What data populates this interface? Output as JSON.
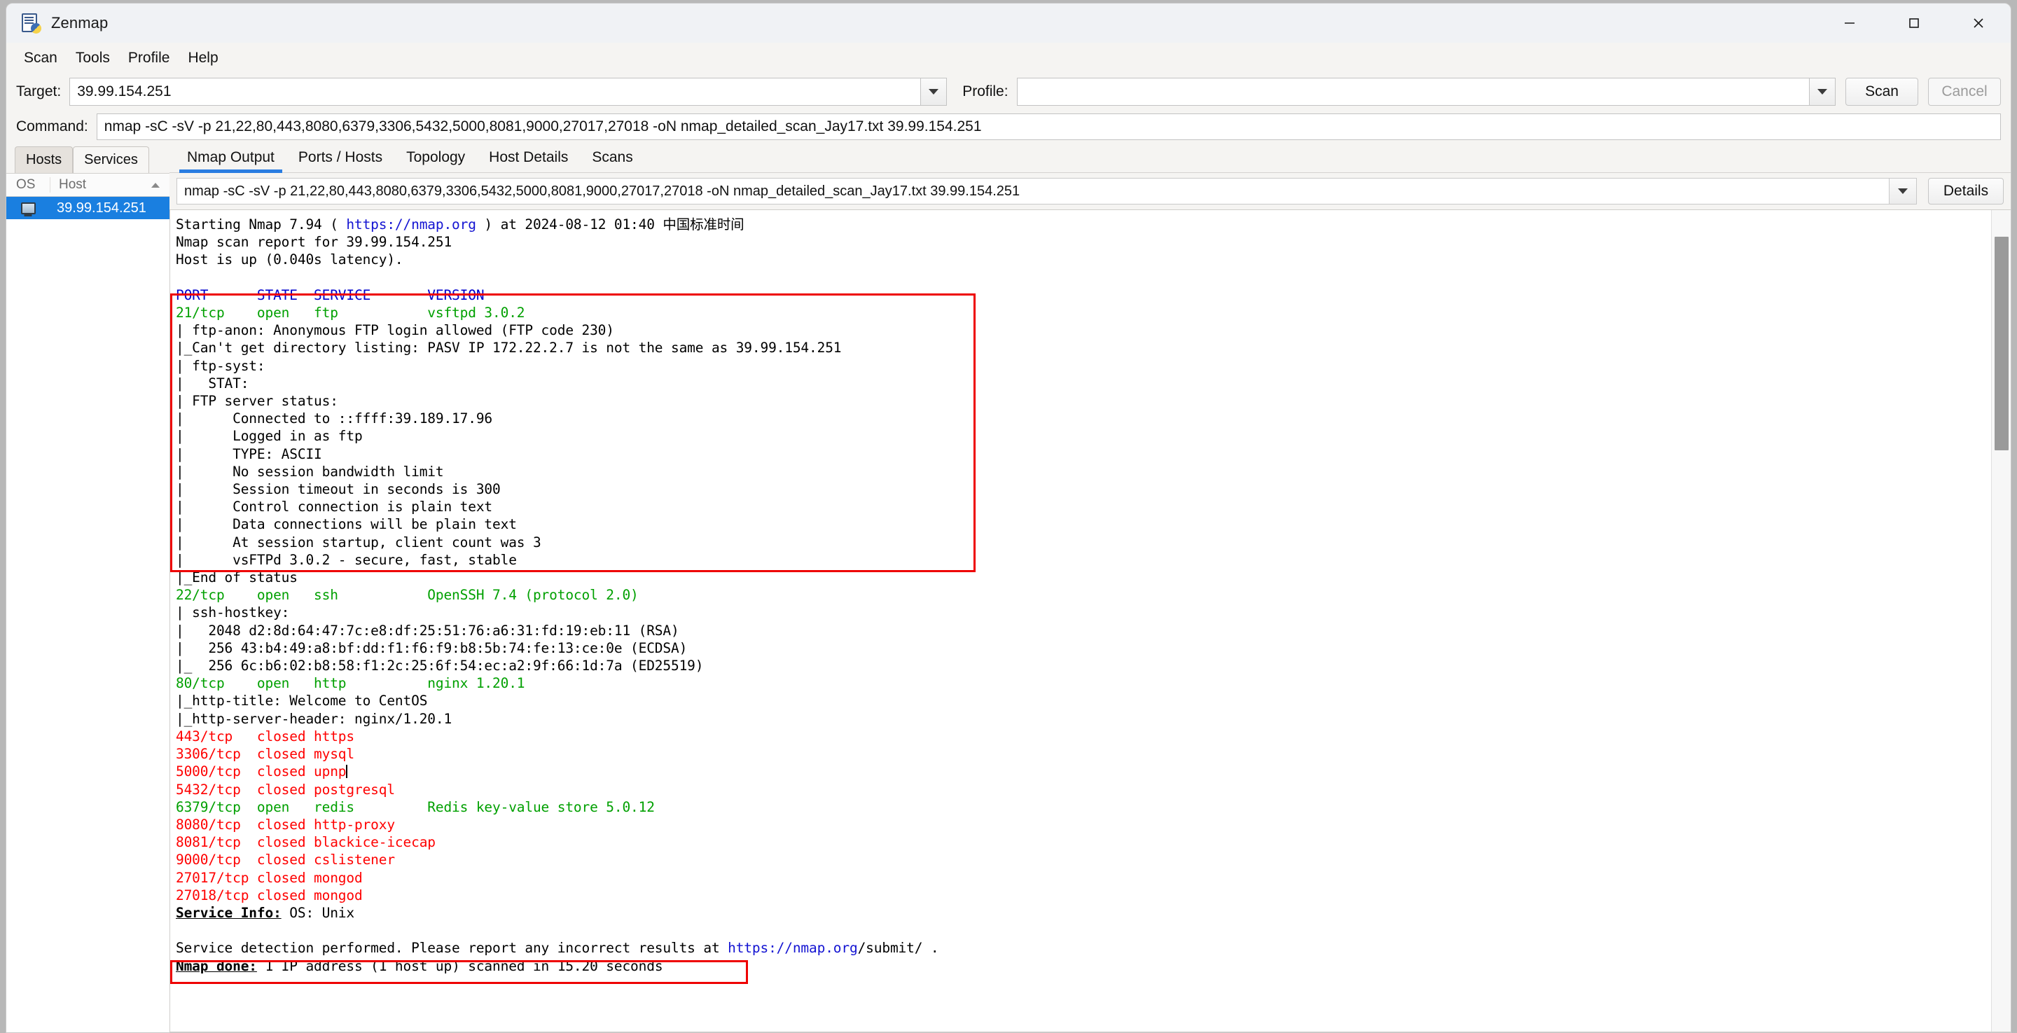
{
  "window": {
    "title": "Zenmap",
    "icon": "zenmap-app-icon",
    "controls": {
      "minimize": "minimize-icon",
      "maximize": "maximize-icon",
      "close": "close-icon"
    }
  },
  "menubar": {
    "items": [
      "Scan",
      "Tools",
      "Profile",
      "Help"
    ]
  },
  "toolbar": {
    "target_label": "Target:",
    "target_value": "39.99.154.251",
    "profile_label": "Profile:",
    "profile_value": "",
    "scan_label": "Scan",
    "cancel_label": "Cancel",
    "command_label": "Command:",
    "command_value": "nmap -sC -sV -p 21,22,80,443,8080,6379,3306,5432,5000,8081,9000,27017,27018 -oN nmap_detailed_scan_Jay17.txt 39.99.154.251"
  },
  "left_panel": {
    "tabs": [
      {
        "label": "Hosts",
        "active": true
      },
      {
        "label": "Services",
        "active": false
      }
    ],
    "columns": {
      "os": "OS",
      "host": "Host",
      "sort": "sort-ascending-icon"
    },
    "hosts": [
      {
        "ip": "39.99.154.251",
        "os_icon": "monitor-icon",
        "selected": true
      }
    ]
  },
  "main_panel": {
    "tabs": [
      {
        "label": "Nmap Output",
        "active": true
      },
      {
        "label": "Ports / Hosts",
        "active": false
      },
      {
        "label": "Topology",
        "active": false
      },
      {
        "label": "Host Details",
        "active": false
      },
      {
        "label": "Scans",
        "active": false
      }
    ],
    "command_display": "nmap -sC -sV -p 21,22,80,443,8080,6379,3306,5432,5000,8081,9000,27017,27018 -oN nmap_detailed_scan_Jay17.txt 39.99.154.251",
    "details_label": "Details"
  },
  "colors": {
    "open_port": "#00a000",
    "closed_port": "#ff0000",
    "header": "#0000cc",
    "link": "#1414d2",
    "highlight_box": "#ee0000",
    "tab_accent": "#2a7de1",
    "selection": "#1a7fe0"
  },
  "nmap_output": {
    "header_lines": [
      {
        "segments": [
          {
            "t": "Starting Nmap 7.94 ( ",
            "c": "k"
          },
          {
            "t": "https://nmap.org",
            "c": "link"
          },
          {
            "t": " ) at 2024-08-12 01:40 中国标准时间",
            "c": "k"
          }
        ]
      },
      {
        "segments": [
          {
            "t": "Nmap scan report for 39.99.154.251",
            "c": "k"
          }
        ]
      },
      {
        "segments": [
          {
            "t": "Host is up (0.040s latency).",
            "c": "k"
          }
        ]
      },
      {
        "segments": [
          {
            "t": "",
            "c": "k"
          }
        ]
      },
      {
        "segments": [
          {
            "t": "PORT      STATE  SERVICE       VERSION",
            "c": "b"
          }
        ]
      }
    ],
    "ftp_block": [
      {
        "segments": [
          {
            "t": "21/tcp    open   ftp           vsftpd 3.0.2",
            "c": "g"
          }
        ]
      },
      {
        "segments": [
          {
            "t": "| ftp-anon: Anonymous FTP login allowed (FTP code 230)",
            "c": "k"
          }
        ]
      },
      {
        "segments": [
          {
            "t": "|_Can't get directory listing: PASV IP 172.22.2.7 is not the same as 39.99.154.251",
            "c": "k"
          }
        ]
      },
      {
        "segments": [
          {
            "t": "| ftp-syst:",
            "c": "k"
          }
        ]
      },
      {
        "segments": [
          {
            "t": "|   STAT:",
            "c": "k"
          }
        ]
      },
      {
        "segments": [
          {
            "t": "| FTP server status:",
            "c": "k"
          }
        ]
      },
      {
        "segments": [
          {
            "t": "|      Connected to ::ffff:39.189.17.96",
            "c": "k"
          }
        ]
      },
      {
        "segments": [
          {
            "t": "|      Logged in as ftp",
            "c": "k"
          }
        ]
      },
      {
        "segments": [
          {
            "t": "|      TYPE: ASCII",
            "c": "k"
          }
        ]
      },
      {
        "segments": [
          {
            "t": "|      No session bandwidth limit",
            "c": "k"
          }
        ]
      },
      {
        "segments": [
          {
            "t": "|      Session timeout in seconds is 300",
            "c": "k"
          }
        ]
      },
      {
        "segments": [
          {
            "t": "|      Control connection is plain text",
            "c": "k"
          }
        ]
      },
      {
        "segments": [
          {
            "t": "|      Data connections will be plain text",
            "c": "k"
          }
        ]
      },
      {
        "segments": [
          {
            "t": "|      At session startup, client count was 3",
            "c": "k"
          }
        ]
      },
      {
        "segments": [
          {
            "t": "|      vsFTPd 3.0.2 - secure, fast, stable",
            "c": "k"
          }
        ]
      },
      {
        "segments": [
          {
            "t": "|_End of status",
            "c": "k"
          }
        ]
      }
    ],
    "ssh_http_block": [
      {
        "segments": [
          {
            "t": "22/tcp    open   ssh           OpenSSH 7.4 (protocol 2.0)",
            "c": "g"
          }
        ]
      },
      {
        "segments": [
          {
            "t": "| ssh-hostkey:",
            "c": "k"
          }
        ]
      },
      {
        "segments": [
          {
            "t": "|   2048 d2:8d:64:47:7c:e8:df:25:51:76:a6:31:fd:19:eb:11 (RSA)",
            "c": "k"
          }
        ]
      },
      {
        "segments": [
          {
            "t": "|   256 43:b4:49:a8:bf:dd:f1:f6:f9:b8:5b:74:fe:13:ce:0e (ECDSA)",
            "c": "k"
          }
        ]
      },
      {
        "segments": [
          {
            "t": "|_  256 6c:b6:02:b8:58:f1:2c:25:6f:54:ec:a2:9f:66:1d:7a (ED25519)",
            "c": "k"
          }
        ]
      },
      {
        "segments": [
          {
            "t": "80/tcp    open   http          nginx 1.20.1",
            "c": "g"
          }
        ]
      },
      {
        "segments": [
          {
            "t": "|_http-title: Welcome to CentOS",
            "c": "k"
          }
        ]
      },
      {
        "segments": [
          {
            "t": "|_http-server-header: nginx/1.20.1",
            "c": "k"
          }
        ]
      }
    ],
    "closed_block_1": [
      {
        "segments": [
          {
            "t": "443/tcp   closed https",
            "c": "r"
          }
        ]
      },
      {
        "segments": [
          {
            "t": "3306/tcp  closed mysql",
            "c": "r"
          }
        ]
      },
      {
        "segments": [
          {
            "t": "5000/tcp  closed upnp",
            "c": "r"
          },
          {
            "t": "CURSOR",
            "c": "cursor"
          }
        ]
      },
      {
        "segments": [
          {
            "t": "5432/tcp  closed postgresql",
            "c": "r"
          }
        ]
      }
    ],
    "redis_block": [
      {
        "segments": [
          {
            "t": "6379/tcp  open   redis         Redis key-value store 5.0.12",
            "c": "g"
          }
        ]
      }
    ],
    "closed_block_2": [
      {
        "segments": [
          {
            "t": "8080/tcp  closed http-proxy",
            "c": "r"
          }
        ]
      },
      {
        "segments": [
          {
            "t": "8081/tcp  closed blackice-icecap",
            "c": "r"
          }
        ]
      },
      {
        "segments": [
          {
            "t": "9000/tcp  closed cslistener",
            "c": "r"
          }
        ]
      },
      {
        "segments": [
          {
            "t": "27017/tcp closed mongod",
            "c": "r"
          }
        ]
      },
      {
        "segments": [
          {
            "t": "27018/tcp closed mongod",
            "c": "r"
          }
        ]
      }
    ],
    "footer_block": [
      {
        "segments": [
          {
            "t": "Service Info:",
            "c": "ku"
          },
          {
            "t": " OS: Unix",
            "c": "k"
          }
        ]
      },
      {
        "segments": [
          {
            "t": "",
            "c": "k"
          }
        ]
      },
      {
        "segments": [
          {
            "t": "Service detection performed. Please report any incorrect results at ",
            "c": "k"
          },
          {
            "t": "https://nmap.org",
            "c": "link"
          },
          {
            "t": "/submit/ .",
            "c": "k"
          }
        ]
      },
      {
        "segments": [
          {
            "t": "Nmap done:",
            "c": "ku"
          },
          {
            "t": " 1 IP address (1 host up) scanned in 15.20 seconds",
            "c": "k"
          }
        ]
      }
    ],
    "highlights": [
      {
        "name": "ftp-highlight-box",
        "color": "#ee0000"
      },
      {
        "name": "redis-highlight-box",
        "color": "#ee0000"
      }
    ]
  }
}
